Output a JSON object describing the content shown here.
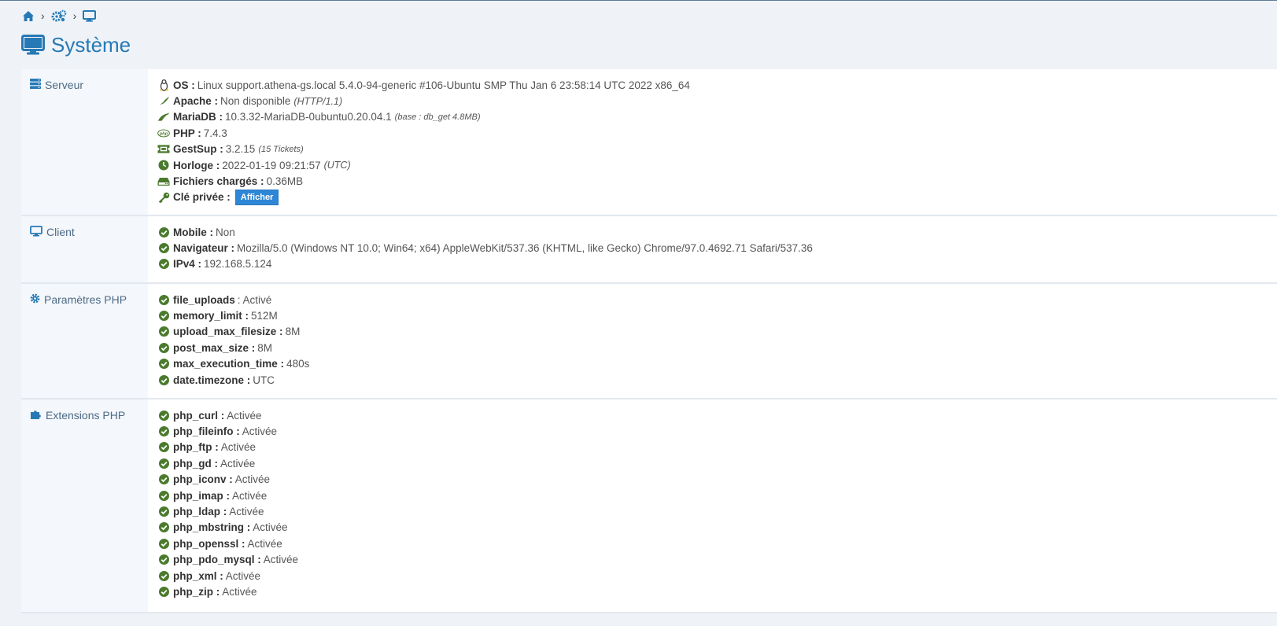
{
  "breadcrumb": {
    "items": [
      "home-icon",
      "cogs-icon",
      "desktop-icon"
    ],
    "sep": "›"
  },
  "title": "Système",
  "colors": {
    "accent": "#2679b5",
    "check": "#4a7a2d"
  },
  "server": {
    "title": "Serveur",
    "rows": [
      {
        "icon": "linux-icon",
        "label": "OS :",
        "value": "Linux support.athena-gs.local 5.4.0-94-generic #106-Ubuntu SMP Thu Jan 6 23:58:14 UTC 2022 x86_64",
        "note": ""
      },
      {
        "icon": "feather-icon",
        "label": "Apache :",
        "value": "Non disponible",
        "note": "(HTTP/1.1)"
      },
      {
        "icon": "dolphin-icon",
        "label": "MariaDB :",
        "value": "10.3.32-MariaDB-0ubuntu0.20.04.1",
        "note": "(base : db_get 4.8MB)"
      },
      {
        "icon": "php-icon",
        "label": "PHP :",
        "value": "7.4.3",
        "note": ""
      },
      {
        "icon": "ticket-icon",
        "label": "GestSup :",
        "value": "3.2.15",
        "note": "(15 Tickets)"
      },
      {
        "icon": "clock-icon",
        "label": "Horloge :",
        "value": "2022-01-19 09:21:57",
        "note": "(UTC)"
      },
      {
        "icon": "hdd-icon",
        "label": "Fichiers chargés :",
        "value": "0.36MB",
        "note": ""
      },
      {
        "icon": "key-icon",
        "label": "Clé privée :",
        "value": "",
        "note": "",
        "button": "Afficher"
      }
    ]
  },
  "client": {
    "title": "Client",
    "rows": [
      {
        "label": "Mobile :",
        "value": "Non"
      },
      {
        "label": "Navigateur :",
        "value": "Mozilla/5.0 (Windows NT 10.0; Win64; x64) AppleWebKit/537.36 (KHTML, like Gecko) Chrome/97.0.4692.71 Safari/537.36"
      },
      {
        "label": "IPv4 :",
        "value": "192.168.5.124"
      }
    ]
  },
  "php_params": {
    "title": "Paramètres PHP",
    "rows": [
      {
        "label": "file_uploads",
        "value": ": Activé"
      },
      {
        "label": "memory_limit :",
        "value": "512M"
      },
      {
        "label": "upload_max_filesize :",
        "value": "8M"
      },
      {
        "label": "post_max_size :",
        "value": "8M"
      },
      {
        "label": "max_execution_time :",
        "value": "480s"
      },
      {
        "label": "date.timezone :",
        "value": "UTC"
      }
    ]
  },
  "php_ext": {
    "title": "Extensions PHP",
    "rows": [
      {
        "label": "php_curl :",
        "value": "Activée"
      },
      {
        "label": "php_fileinfo :",
        "value": "Activée"
      },
      {
        "label": "php_ftp :",
        "value": "Activée"
      },
      {
        "label": "php_gd :",
        "value": "Activée"
      },
      {
        "label": "php_iconv :",
        "value": "Activée"
      },
      {
        "label": "php_imap :",
        "value": "Activée"
      },
      {
        "label": "php_ldap :",
        "value": "Activée"
      },
      {
        "label": "php_mbstring :",
        "value": "Activée"
      },
      {
        "label": "php_openssl :",
        "value": "Activée"
      },
      {
        "label": "php_pdo_mysql :",
        "value": "Activée"
      },
      {
        "label": "php_xml :",
        "value": "Activée"
      },
      {
        "label": "php_zip :",
        "value": "Activée"
      }
    ]
  }
}
